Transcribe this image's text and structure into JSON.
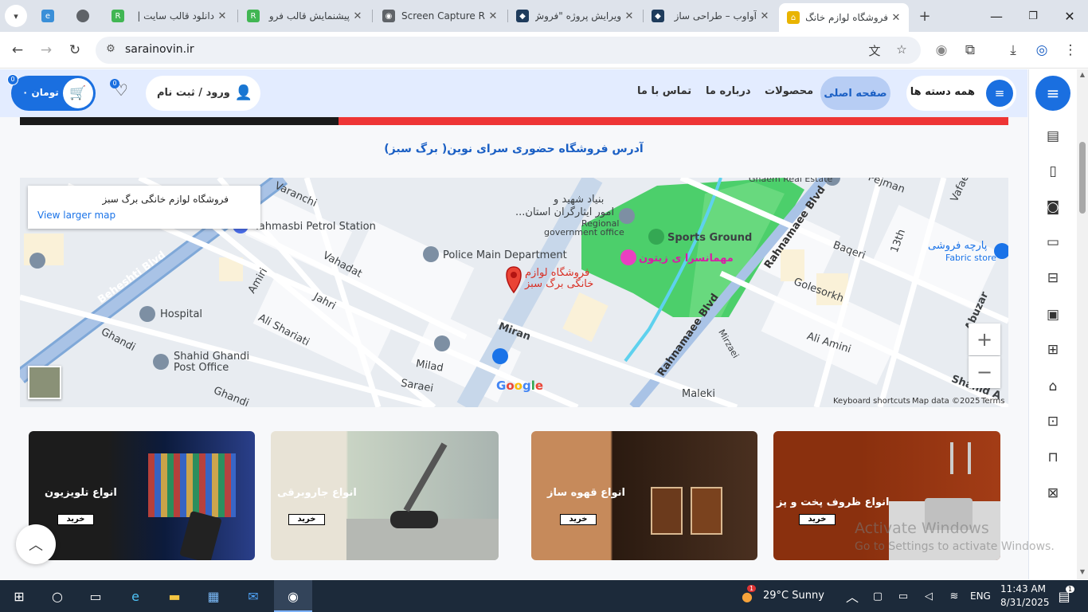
{
  "browser": {
    "tabs": [
      {
        "title": "",
        "icon": "edge-icon",
        "color": "#3a8fd8"
      },
      {
        "title": "",
        "icon": "globe-icon",
        "color": "#5f6368"
      },
      {
        "title": "دانلود قالب سایت |",
        "icon": "rtl-theme-icon",
        "color": "#41b653"
      },
      {
        "title": "پیشنمایش قالب فرو",
        "icon": "rtl-theme-icon",
        "color": "#41b653"
      },
      {
        "title": "Screen Capture Re",
        "icon": "camera-icon",
        "color": "#5f6368"
      },
      {
        "title": "ویرایش پروژه \"فروش",
        "icon": "app-icon",
        "color": "#1f3c5c"
      },
      {
        "title": "آواوب – طراحی ساز",
        "icon": "app-icon",
        "color": "#1f3c5c"
      },
      {
        "title": "فروشگاه لوازم خانگ",
        "icon": "house-icon",
        "color": "#e9b400",
        "active": true
      }
    ],
    "url": "sarainovin.ir"
  },
  "header": {
    "all_categories": "همه دسته ها",
    "nav": [
      "صفحه اصلی",
      "محصولات",
      "درباره ما",
      "تماس با ما"
    ],
    "login": "ورود / ثبت نام",
    "favorites_count": "0",
    "cart_label": "۰ تومان",
    "cart_count": "0"
  },
  "section_title": "آدرس فروشگاه حضوری سرای نوین( برگ سبز)",
  "map": {
    "place_name": "فروشگاه لوازم خانگی برگ سبز",
    "larger_map_link": "View larger map",
    "pin_label_1": "فروشگاه لوازم",
    "pin_label_2": "خانگی برگ سبز",
    "labels": {
      "beheshti": "Beheshti Blvd",
      "tahmasbi": "Tahmasbi Petrol Station",
      "police": "Police Main Department",
      "hospital": "Hospital",
      "post_office_1": "Shahid Ghandi",
      "post_office_2": "Post Office",
      "sports": "Sports Ground",
      "guesthouse": "مهمانسرا ی زیتون",
      "regional_1": "Regional",
      "regional_2": "government office",
      "foundation_1": "بنیاد شهید و",
      "foundation_2": "امور ایثارگران استان...",
      "rahnamaee": "Rahnamaee Blvd",
      "rahnamaee2": "Rahnamaee Blvd",
      "fabric_fa": "پارچه فروشی",
      "fabric_en": "Fabric store",
      "vahadat": "Vahadat",
      "amiri": "Amiri",
      "jahri": "Jahri",
      "ali_shariati": "Ali Shariati",
      "ghandi": "Ghandi",
      "milad": "Milad",
      "saraei": "Saraei",
      "miran": "Miran",
      "maleki": "Maleki",
      "golesorkh": "Golesorkh",
      "baqeri": "Baqeri",
      "pejman": "Pejman",
      "ali_amini": "Ali Amini",
      "abuzar": "Abuzar",
      "shahid_a": "Shahid A",
      "mirzaei": "Mirzaei",
      "thirteenth": "13th",
      "vafaee": "Vafaee",
      "ghaem": "Ghaem Real Estate",
      "varanchi": "Varanchi",
      "ghandi2": "Ghandi"
    },
    "google": "Google",
    "keyboard": "Keyboard shortcuts",
    "map_data": "Map data ©2025",
    "terms": "Terms"
  },
  "cards": [
    {
      "title": "انواع تلویزیون",
      "button": "خرید"
    },
    {
      "title": "انواع جاروبرقی",
      "button": "خرید"
    },
    {
      "title": "انواع قهوه ساز",
      "button": "خرید"
    },
    {
      "title": "انواع ظروف پخت و پز",
      "button": "خرید"
    }
  ],
  "watermark": {
    "line1": "Activate Windows",
    "line2": "Go to Settings to activate Windows."
  },
  "taskbar": {
    "weather": "29°C  Sunny",
    "weather_badge": "1",
    "lang": "ENG",
    "time": "11:43 AM",
    "date": "8/31/2025",
    "notif": "1"
  },
  "colors": {
    "brand": "#1a6fe0",
    "header_bg": "#e3ecff",
    "banner_red": "#ee3535"
  }
}
